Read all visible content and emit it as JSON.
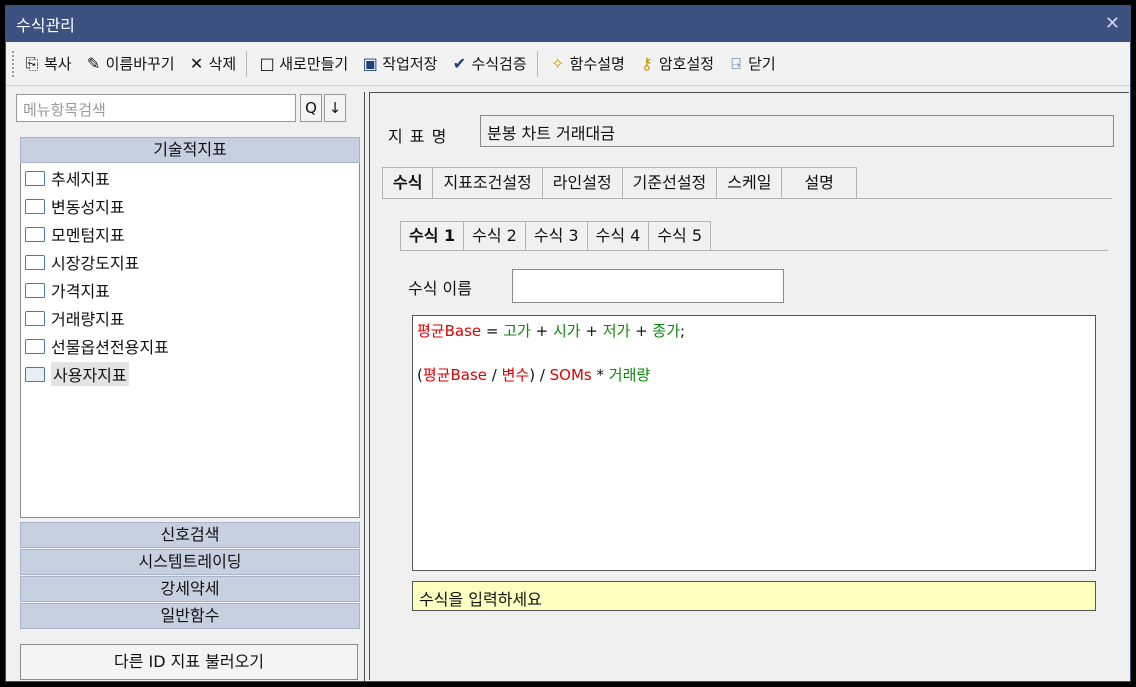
{
  "window": {
    "title": "수식관리",
    "close_glyph": "✕"
  },
  "toolbar": {
    "copy": "복사",
    "rename": "이름바꾸기",
    "delete": "삭제",
    "new": "새로만들기",
    "save": "작업저장",
    "verify": "수식검증",
    "func_help": "함수설명",
    "password": "암호설정",
    "close": "닫기"
  },
  "left": {
    "search_placeholder": "메뉴항목검색",
    "search_btn": "Q",
    "down_btn": "↓",
    "category_top": "기술적지표",
    "tree": [
      {
        "label": "추세지표"
      },
      {
        "label": "변동성지표"
      },
      {
        "label": "모멘텀지표"
      },
      {
        "label": "시장강도지표"
      },
      {
        "label": "가격지표"
      },
      {
        "label": "거래량지표"
      },
      {
        "label": "선물옵션전용지표"
      },
      {
        "label": "사용자지표"
      }
    ],
    "categories_bottom": [
      "신호검색",
      "시스템트레이딩",
      "강세약세",
      "일반함수"
    ],
    "load_button": "다른 ID 지표 불러오기"
  },
  "right": {
    "name_label": "지 표 명",
    "name_value": "분봉 차트 거래대금",
    "tabs": [
      "수식",
      "지표조건설정",
      "라인설정",
      "기준선설정",
      "스케일",
      "설명"
    ],
    "subtabs": [
      "수식 1",
      "수식 2",
      "수식 3",
      "수식 4",
      "수식 5"
    ],
    "formula_name_label": "수식 이름",
    "formula_name_value": "",
    "code": {
      "l1": {
        "a": "평균Base",
        "b": " = ",
        "c": "고가",
        "d": " + ",
        "e": "시가",
        "f": " + ",
        "g": "저가",
        "h": " + ",
        "i": "종가",
        "j": ";"
      },
      "l3": {
        "a": "(",
        "b": "평균Base",
        "c": " / ",
        "d": "변수",
        "e": ") / ",
        "f": "SOMs",
        "g": " * ",
        "h": "거래량"
      }
    },
    "hint": "수식을 입력하세요"
  },
  "colors": {
    "title_bar": "#3d5180",
    "category": "#c7d0e0",
    "hint_bg": "#ffffc0",
    "keyword_red": "#e00000",
    "keyword_green": "#0a8a0a"
  }
}
